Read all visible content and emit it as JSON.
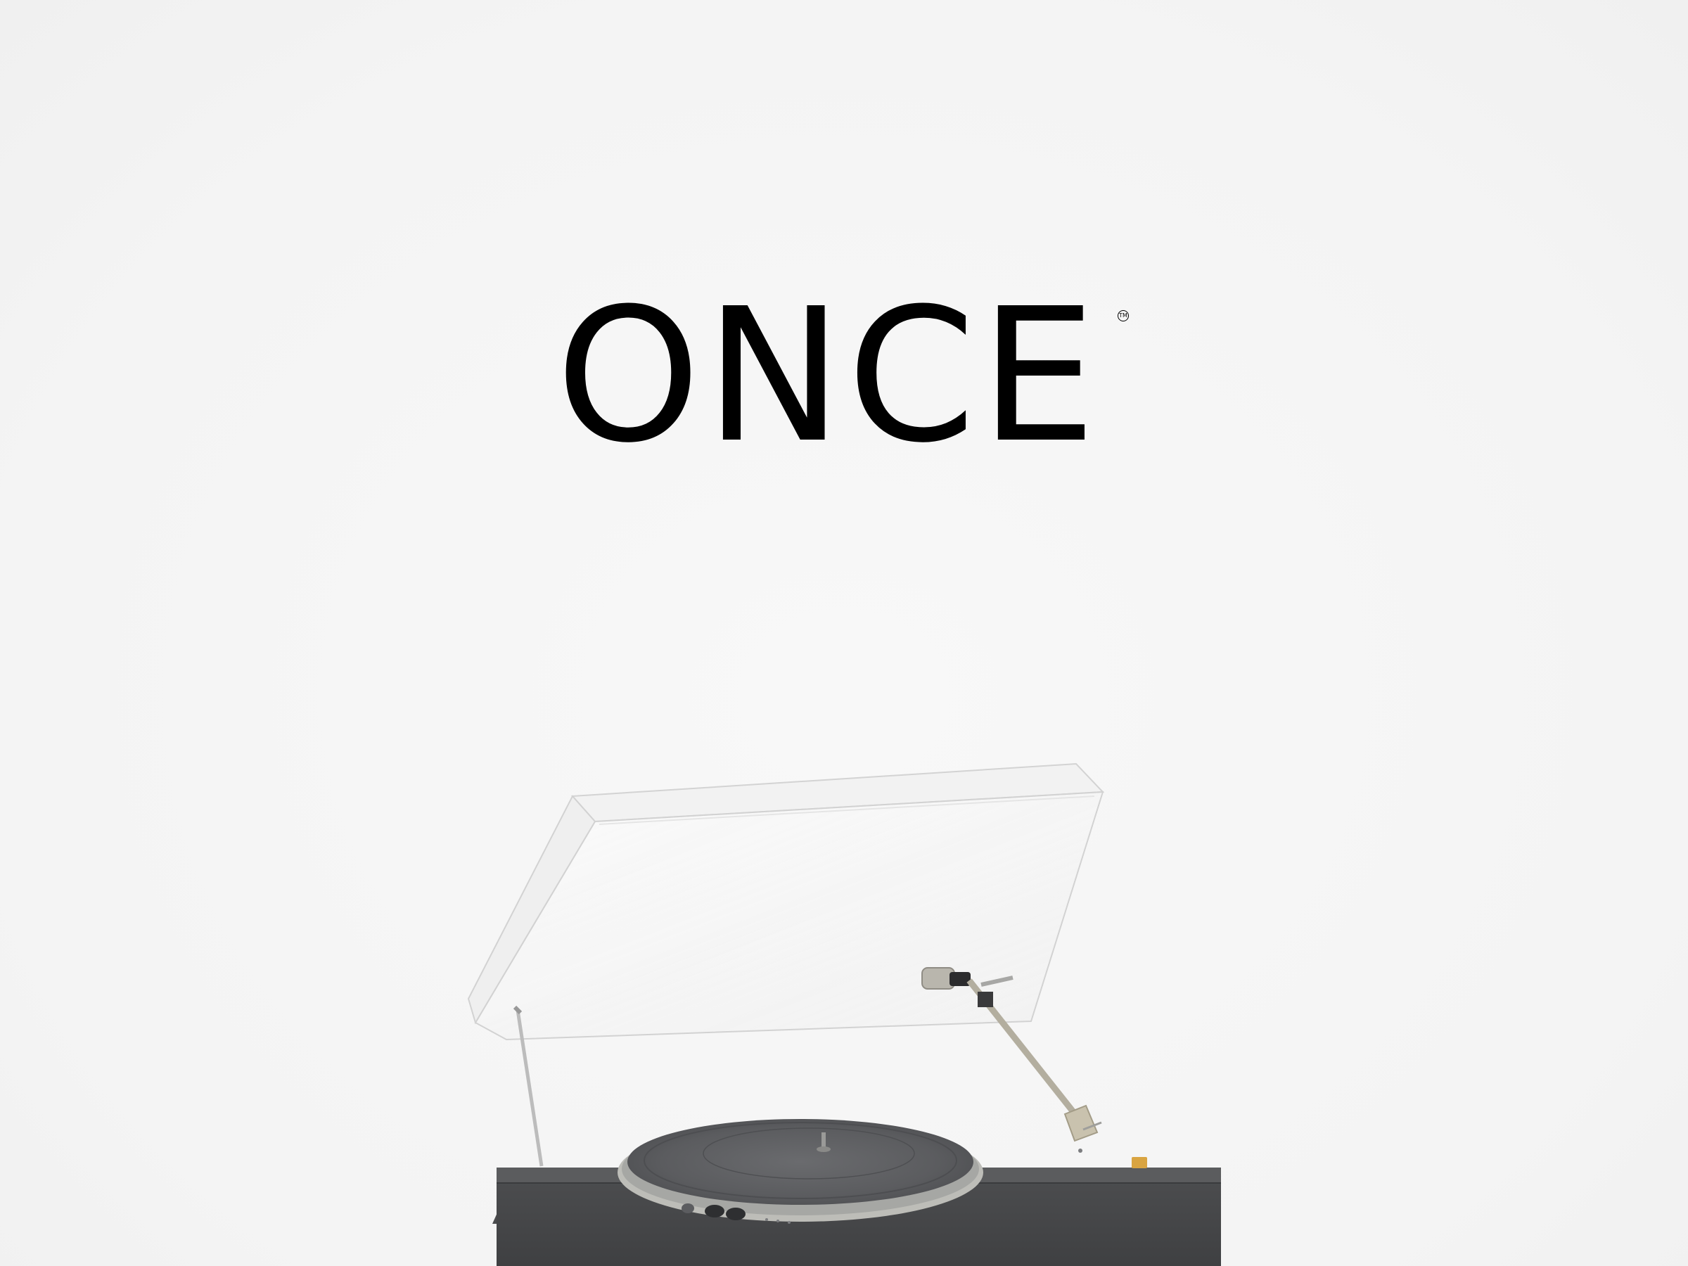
{
  "brand": {
    "wordmark": "ONCE",
    "trademark": "TM"
  },
  "illustration": {
    "subject": "turntable-with-open-dust-cover",
    "colors": {
      "background": "#f6f6f6",
      "plinth": "#4a4b4d",
      "platter": "#5a5b5e",
      "platter_rim": "#a8a9a6",
      "tonearm": "#b8b4a8",
      "accent_button": "#d9a441"
    }
  }
}
